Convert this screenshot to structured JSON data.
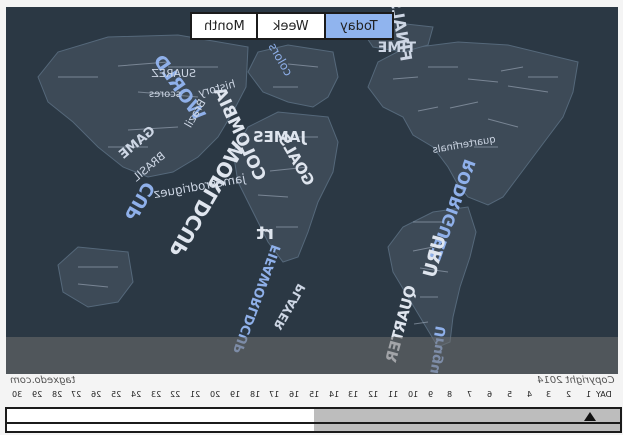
{
  "tabs": {
    "month": "Month",
    "week": "Week",
    "today": "Today",
    "active": "today"
  },
  "colors": {
    "map_background": "#2b3844",
    "land_text": "#cdd6e4",
    "accent_text": "#8fb0ea",
    "active_tab": "#90b4ee",
    "timeline_fill": "#bdbdbd"
  },
  "wordcloud": {
    "words": [
      "FINALS",
      "TIME",
      "WORLDCUP",
      "WORLD",
      "CUP",
      "COLOMBIA",
      "GOALS",
      "JAMES",
      "FIFAWORLDCUP",
      "jamesrodriguez",
      "RODRIGUEZ",
      "Brazil",
      "history",
      "colors",
      "SUAREZ",
      "scores",
      "GAME",
      "BRASIL",
      "PLAYER",
      "QUARTER",
      "URU",
      "Uruguay",
      "quarterfinals",
      "rt"
    ]
  },
  "footer": {
    "left_text": "tagxedo.com",
    "right_text": "Copyright 2014",
    "day_label": "DAY",
    "days": [
      "1",
      "2",
      "3",
      "4",
      "5",
      "6",
      "7",
      "8",
      "9",
      "10",
      "11",
      "12",
      "13",
      "14",
      "15",
      "16",
      "17",
      "18",
      "19",
      "20",
      "21",
      "22",
      "23",
      "24",
      "25",
      "26",
      "27",
      "28",
      "29",
      "30"
    ]
  },
  "timeline": {
    "selected_day": 1,
    "total_days": 30,
    "highlight_fraction": 0.5
  }
}
